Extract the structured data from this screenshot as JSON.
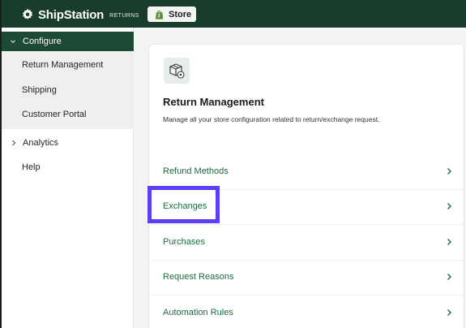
{
  "header": {
    "brand": "ShipStation",
    "brand_sub": "RETURNS",
    "store_button": "Store",
    "brand_color": "#183d2b"
  },
  "sidebar": {
    "configure": {
      "label": "Configure",
      "expanded": true,
      "items": [
        {
          "label": "Return Management"
        },
        {
          "label": "Shipping"
        },
        {
          "label": "Customer Portal"
        }
      ]
    },
    "analytics": {
      "label": "Analytics",
      "expanded": false
    },
    "help": {
      "label": "Help"
    }
  },
  "main": {
    "icon": "package-settings-icon",
    "title": "Return Management",
    "description": "Manage all your store configuration related to return/exchange request.",
    "links": [
      {
        "label": "Refund Methods"
      },
      {
        "label": "Exchanges",
        "highlighted": true
      },
      {
        "label": "Purchases"
      },
      {
        "label": "Request Reasons"
      },
      {
        "label": "Automation Rules"
      }
    ]
  },
  "colors": {
    "accent": "#1d4a34",
    "link": "#1e6b41",
    "highlight": "#5b3ff0"
  }
}
